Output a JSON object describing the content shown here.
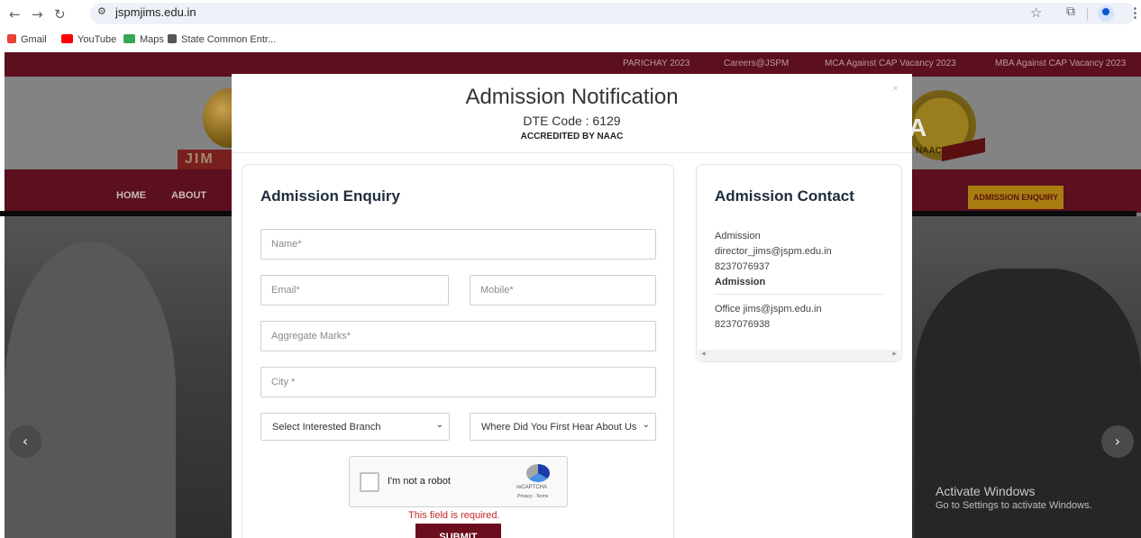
{
  "browser": {
    "url": "jspmjims.edu.in",
    "nav_icons": [
      "back-icon",
      "forward-icon",
      "reload-icon"
    ],
    "bookmarks": [
      {
        "label": "Gmail",
        "icon": "gmail-icon",
        "color": "#ea4335"
      },
      {
        "label": "YouTube",
        "icon": "youtube-icon",
        "color": "#ff0000"
      },
      {
        "label": "Maps",
        "icon": "maps-icon",
        "color": "#34a853"
      },
      {
        "label": "State Common Entr...",
        "icon": "emblem-icon",
        "color": "#555555"
      }
    ]
  },
  "site": {
    "top_links": [
      "PARICHAY 2023",
      "Careers@JSPM",
      "MCA Against CAP Vacancy 2023",
      "MBA Against CAP Vacancy 2023"
    ],
    "logo_text": "JIM",
    "naac_text": "NAAC",
    "naac_grade": "A",
    "nav": {
      "home": "HOME",
      "about": "ABOUT",
      "enquiry": "ADMISSION ENQUIRY"
    },
    "carousel": {
      "prev": "‹",
      "next": "›"
    },
    "brand_color": "#6b0d1d",
    "accent_color": "#a87d10"
  },
  "modal": {
    "title": "Admission Notification",
    "dte_code": "DTE Code : 6129",
    "accreditation": "ACCREDITED BY NAAC",
    "close": "×",
    "enquiry": {
      "title": "Admission Enquiry",
      "name_placeholder": "Name*",
      "email_placeholder": "Email*",
      "mobile_placeholder": "Mobile*",
      "marks_placeholder": "Aggregate Marks*",
      "city_placeholder": "City *",
      "branch_select": "Select Interested Branch",
      "source_select": "Where Did You First Hear About Us",
      "captcha_label": "I'm not a robot",
      "captcha_brand": "reCAPTCHA",
      "captcha_links": "Privacy - Terms",
      "captcha_error": "This field is required.",
      "submit": "SUBMIT"
    },
    "contact": {
      "title": "Admission Contact",
      "line1": "Admission",
      "line2": "director_jims@jspm.edu.in",
      "line3": "8237076937",
      "line4": "Admission",
      "line5": "Office jims@jspm.edu.in",
      "line6": "8237076938"
    }
  },
  "os_overlay": {
    "line1": "Activate Windows",
    "line2": "Go to Settings to activate Windows."
  }
}
